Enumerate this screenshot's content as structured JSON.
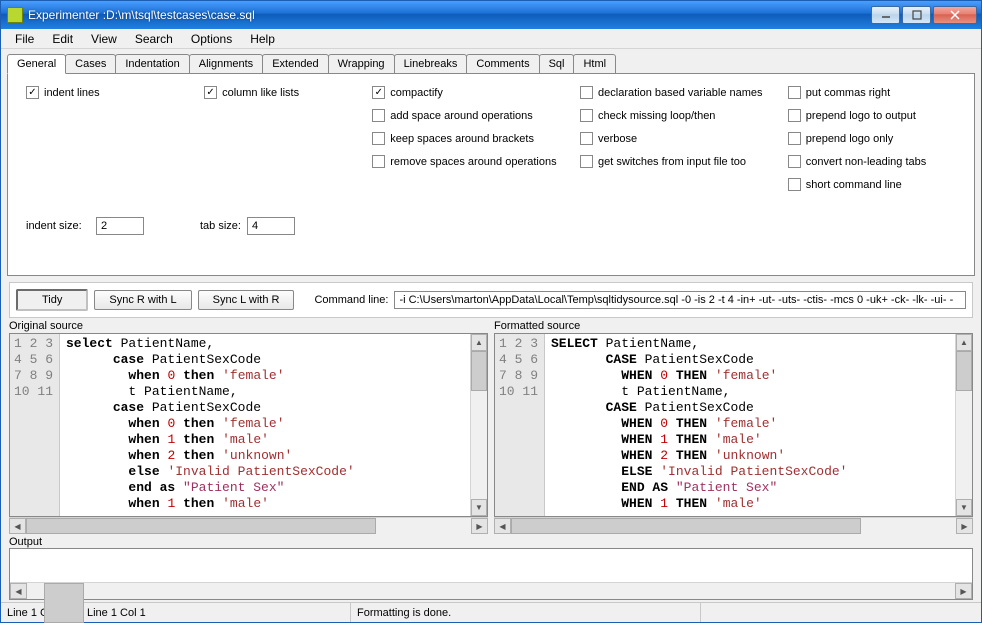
{
  "title": "Experimenter :D:\\m\\tsql\\testcases\\case.sql",
  "menu": [
    "File",
    "Edit",
    "View",
    "Search",
    "Options",
    "Help"
  ],
  "tabs": [
    "General",
    "Cases",
    "Indentation",
    "Alignments",
    "Extended",
    "Wrapping",
    "Linebreaks",
    "Comments",
    "Sql",
    "Html"
  ],
  "activeTab": 0,
  "options": {
    "col1": [
      {
        "label": "indent lines",
        "checked": true
      }
    ],
    "col2": [
      {
        "label": "column like lists",
        "checked": true
      }
    ],
    "col3": [
      {
        "label": "compactify",
        "checked": true
      },
      {
        "label": "add space around operations",
        "checked": false
      },
      {
        "label": "keep spaces around brackets",
        "checked": false
      },
      {
        "label": "remove spaces around operations",
        "checked": false
      }
    ],
    "col4": [
      {
        "label": "declaration based variable names",
        "checked": false
      },
      {
        "label": "check missing loop/then",
        "checked": false
      },
      {
        "label": "verbose",
        "checked": false
      },
      {
        "label": "get switches from input file  too",
        "checked": false
      }
    ],
    "col5": [
      {
        "label": "put commas right",
        "checked": false
      },
      {
        "label": "prepend logo to output",
        "checked": false
      },
      {
        "label": "prepend logo only",
        "checked": false
      },
      {
        "label": "convert non-leading tabs",
        "checked": false
      },
      {
        "label": "short command line",
        "checked": false
      }
    ]
  },
  "sizes": {
    "indentLabel": "indent size:",
    "indentValue": "2",
    "tabLabel": "tab size:",
    "tabValue": "4"
  },
  "buttons": {
    "tidy": "Tidy",
    "syncRL": "Sync R with L",
    "syncLR": "Sync L with R"
  },
  "commandLineLabel": "Command line:",
  "commandLine": "-i C:\\Users\\marton\\AppData\\Local\\Temp\\sqltidysource.sql -0 -is 2 -t 4 -in+ -ut- -uts- -ctis- -mcs 0 -uk+ -ck- -lk- -ui- -",
  "panels": {
    "originalLabel": "Original source",
    "formattedLabel": "Formatted source"
  },
  "lineNumbers": [
    "1",
    "2",
    "3",
    "4",
    "5",
    "6",
    "7",
    "8",
    "9",
    "10",
    "11"
  ],
  "original_tokens": [
    [
      [
        "kw",
        "select"
      ],
      [
        "",
        " PatientName,"
      ]
    ],
    [
      [
        "",
        "      "
      ],
      [
        "kw",
        "case"
      ],
      [
        "",
        " PatientSexCode"
      ]
    ],
    [
      [
        "",
        "        "
      ],
      [
        "kw",
        "when"
      ],
      [
        "",
        " "
      ],
      [
        "num",
        "0"
      ],
      [
        "",
        " "
      ],
      [
        "kw",
        "then"
      ],
      [
        "",
        " "
      ],
      [
        "str",
        "'female'"
      ]
    ],
    [
      [
        "",
        "        t PatientName,"
      ]
    ],
    [
      [
        "",
        "      "
      ],
      [
        "kw",
        "case"
      ],
      [
        "",
        " PatientSexCode"
      ]
    ],
    [
      [
        "",
        "        "
      ],
      [
        "kw",
        "when"
      ],
      [
        "",
        " "
      ],
      [
        "num",
        "0"
      ],
      [
        "",
        " "
      ],
      [
        "kw",
        "then"
      ],
      [
        "",
        " "
      ],
      [
        "str",
        "'female'"
      ]
    ],
    [
      [
        "",
        "        "
      ],
      [
        "kw",
        "when"
      ],
      [
        "",
        " "
      ],
      [
        "num",
        "1"
      ],
      [
        "",
        " "
      ],
      [
        "kw",
        "then"
      ],
      [
        "",
        " "
      ],
      [
        "str",
        "'male'"
      ]
    ],
    [
      [
        "",
        "        "
      ],
      [
        "kw",
        "when"
      ],
      [
        "",
        " "
      ],
      [
        "num",
        "2"
      ],
      [
        "",
        " "
      ],
      [
        "kw",
        "then"
      ],
      [
        "",
        " "
      ],
      [
        "str",
        "'unknown'"
      ]
    ],
    [
      [
        "",
        "        "
      ],
      [
        "kw",
        "else"
      ],
      [
        "",
        " "
      ],
      [
        "str",
        "'Invalid PatientSexCode'"
      ]
    ],
    [
      [
        "",
        "        "
      ],
      [
        "kw",
        "end as"
      ],
      [
        "",
        " "
      ],
      [
        "dq",
        "\"Patient Sex\""
      ]
    ],
    [
      [
        "",
        "        "
      ],
      [
        "kw",
        "when"
      ],
      [
        "",
        " "
      ],
      [
        "num",
        "1"
      ],
      [
        "",
        " "
      ],
      [
        "kw",
        "then"
      ],
      [
        "",
        " "
      ],
      [
        "str",
        "'male'"
      ]
    ]
  ],
  "formatted_tokens": [
    [
      [
        "kw",
        "SELECT"
      ],
      [
        "",
        " PatientName,"
      ]
    ],
    [
      [
        "",
        "       "
      ],
      [
        "kw",
        "CASE"
      ],
      [
        "",
        " PatientSexCode"
      ]
    ],
    [
      [
        "",
        "         "
      ],
      [
        "kw",
        "WHEN"
      ],
      [
        "",
        " "
      ],
      [
        "num",
        "0"
      ],
      [
        "",
        " "
      ],
      [
        "kw",
        "THEN"
      ],
      [
        "",
        " "
      ],
      [
        "str",
        "'female'"
      ]
    ],
    [
      [
        "",
        "         t PatientName,"
      ]
    ],
    [
      [
        "",
        "       "
      ],
      [
        "kw",
        "CASE"
      ],
      [
        "",
        " PatientSexCode"
      ]
    ],
    [
      [
        "",
        "         "
      ],
      [
        "kw",
        "WHEN"
      ],
      [
        "",
        " "
      ],
      [
        "num",
        "0"
      ],
      [
        "",
        " "
      ],
      [
        "kw",
        "THEN"
      ],
      [
        "",
        " "
      ],
      [
        "str",
        "'female'"
      ]
    ],
    [
      [
        "",
        "         "
      ],
      [
        "kw",
        "WHEN"
      ],
      [
        "",
        " "
      ],
      [
        "num",
        "1"
      ],
      [
        "",
        " "
      ],
      [
        "kw",
        "THEN"
      ],
      [
        "",
        " "
      ],
      [
        "str",
        "'male'"
      ]
    ],
    [
      [
        "",
        "         "
      ],
      [
        "kw",
        "WHEN"
      ],
      [
        "",
        " "
      ],
      [
        "num",
        "2"
      ],
      [
        "",
        " "
      ],
      [
        "kw",
        "THEN"
      ],
      [
        "",
        " "
      ],
      [
        "str",
        "'unknown'"
      ]
    ],
    [
      [
        "",
        "         "
      ],
      [
        "kw",
        "ELSE"
      ],
      [
        "",
        " "
      ],
      [
        "str",
        "'Invalid PatientSexCode'"
      ]
    ],
    [
      [
        "",
        "         "
      ],
      [
        "kw",
        "END AS"
      ],
      [
        "",
        " "
      ],
      [
        "dq",
        "\"Patient Sex\""
      ]
    ],
    [
      [
        "",
        "         "
      ],
      [
        "kw",
        "WHEN"
      ],
      [
        "",
        " "
      ],
      [
        "num",
        "1"
      ],
      [
        "",
        " "
      ],
      [
        "kw",
        "THEN"
      ],
      [
        "",
        " "
      ],
      [
        "str",
        "'male'"
      ]
    ]
  ],
  "outputLabel": "Output",
  "status": {
    "left": "Line 1 Col 1",
    "right": "Line 1 Col 1",
    "msg": "Formatting is done."
  }
}
